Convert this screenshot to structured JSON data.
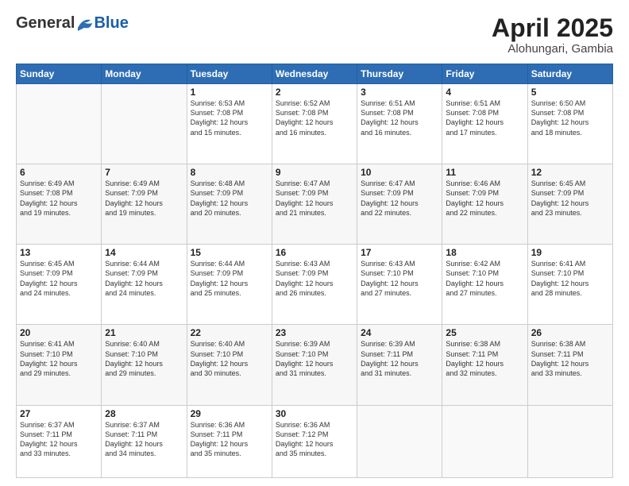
{
  "header": {
    "logo_general": "General",
    "logo_blue": "Blue",
    "month_year": "April 2025",
    "location": "Alohungari, Gambia"
  },
  "days_of_week": [
    "Sunday",
    "Monday",
    "Tuesday",
    "Wednesday",
    "Thursday",
    "Friday",
    "Saturday"
  ],
  "weeks": [
    [
      {
        "day": "",
        "info": ""
      },
      {
        "day": "",
        "info": ""
      },
      {
        "day": "1",
        "info": "Sunrise: 6:53 AM\nSunset: 7:08 PM\nDaylight: 12 hours\nand 15 minutes."
      },
      {
        "day": "2",
        "info": "Sunrise: 6:52 AM\nSunset: 7:08 PM\nDaylight: 12 hours\nand 16 minutes."
      },
      {
        "day": "3",
        "info": "Sunrise: 6:51 AM\nSunset: 7:08 PM\nDaylight: 12 hours\nand 16 minutes."
      },
      {
        "day": "4",
        "info": "Sunrise: 6:51 AM\nSunset: 7:08 PM\nDaylight: 12 hours\nand 17 minutes."
      },
      {
        "day": "5",
        "info": "Sunrise: 6:50 AM\nSunset: 7:08 PM\nDaylight: 12 hours\nand 18 minutes."
      }
    ],
    [
      {
        "day": "6",
        "info": "Sunrise: 6:49 AM\nSunset: 7:08 PM\nDaylight: 12 hours\nand 19 minutes."
      },
      {
        "day": "7",
        "info": "Sunrise: 6:49 AM\nSunset: 7:09 PM\nDaylight: 12 hours\nand 19 minutes."
      },
      {
        "day": "8",
        "info": "Sunrise: 6:48 AM\nSunset: 7:09 PM\nDaylight: 12 hours\nand 20 minutes."
      },
      {
        "day": "9",
        "info": "Sunrise: 6:47 AM\nSunset: 7:09 PM\nDaylight: 12 hours\nand 21 minutes."
      },
      {
        "day": "10",
        "info": "Sunrise: 6:47 AM\nSunset: 7:09 PM\nDaylight: 12 hours\nand 22 minutes."
      },
      {
        "day": "11",
        "info": "Sunrise: 6:46 AM\nSunset: 7:09 PM\nDaylight: 12 hours\nand 22 minutes."
      },
      {
        "day": "12",
        "info": "Sunrise: 6:45 AM\nSunset: 7:09 PM\nDaylight: 12 hours\nand 23 minutes."
      }
    ],
    [
      {
        "day": "13",
        "info": "Sunrise: 6:45 AM\nSunset: 7:09 PM\nDaylight: 12 hours\nand 24 minutes."
      },
      {
        "day": "14",
        "info": "Sunrise: 6:44 AM\nSunset: 7:09 PM\nDaylight: 12 hours\nand 24 minutes."
      },
      {
        "day": "15",
        "info": "Sunrise: 6:44 AM\nSunset: 7:09 PM\nDaylight: 12 hours\nand 25 minutes."
      },
      {
        "day": "16",
        "info": "Sunrise: 6:43 AM\nSunset: 7:09 PM\nDaylight: 12 hours\nand 26 minutes."
      },
      {
        "day": "17",
        "info": "Sunrise: 6:43 AM\nSunset: 7:10 PM\nDaylight: 12 hours\nand 27 minutes."
      },
      {
        "day": "18",
        "info": "Sunrise: 6:42 AM\nSunset: 7:10 PM\nDaylight: 12 hours\nand 27 minutes."
      },
      {
        "day": "19",
        "info": "Sunrise: 6:41 AM\nSunset: 7:10 PM\nDaylight: 12 hours\nand 28 minutes."
      }
    ],
    [
      {
        "day": "20",
        "info": "Sunrise: 6:41 AM\nSunset: 7:10 PM\nDaylight: 12 hours\nand 29 minutes."
      },
      {
        "day": "21",
        "info": "Sunrise: 6:40 AM\nSunset: 7:10 PM\nDaylight: 12 hours\nand 29 minutes."
      },
      {
        "day": "22",
        "info": "Sunrise: 6:40 AM\nSunset: 7:10 PM\nDaylight: 12 hours\nand 30 minutes."
      },
      {
        "day": "23",
        "info": "Sunrise: 6:39 AM\nSunset: 7:10 PM\nDaylight: 12 hours\nand 31 minutes."
      },
      {
        "day": "24",
        "info": "Sunrise: 6:39 AM\nSunset: 7:11 PM\nDaylight: 12 hours\nand 31 minutes."
      },
      {
        "day": "25",
        "info": "Sunrise: 6:38 AM\nSunset: 7:11 PM\nDaylight: 12 hours\nand 32 minutes."
      },
      {
        "day": "26",
        "info": "Sunrise: 6:38 AM\nSunset: 7:11 PM\nDaylight: 12 hours\nand 33 minutes."
      }
    ],
    [
      {
        "day": "27",
        "info": "Sunrise: 6:37 AM\nSunset: 7:11 PM\nDaylight: 12 hours\nand 33 minutes."
      },
      {
        "day": "28",
        "info": "Sunrise: 6:37 AM\nSunset: 7:11 PM\nDaylight: 12 hours\nand 34 minutes."
      },
      {
        "day": "29",
        "info": "Sunrise: 6:36 AM\nSunset: 7:11 PM\nDaylight: 12 hours\nand 35 minutes."
      },
      {
        "day": "30",
        "info": "Sunrise: 6:36 AM\nSunset: 7:12 PM\nDaylight: 12 hours\nand 35 minutes."
      },
      {
        "day": "",
        "info": ""
      },
      {
        "day": "",
        "info": ""
      },
      {
        "day": "",
        "info": ""
      }
    ]
  ]
}
